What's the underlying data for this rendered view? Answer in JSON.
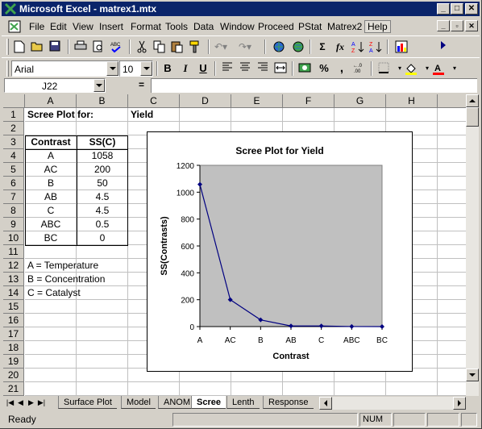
{
  "window": {
    "title": "Microsoft Excel - matrex1.mtx",
    "title_buttons": [
      "_",
      "□",
      "✕"
    ]
  },
  "menu": {
    "items": [
      "File",
      "Edit",
      "View",
      "Insert",
      "Format",
      "Tools",
      "Data",
      "Window",
      "Proceed",
      "PStat",
      "Matrex2",
      "Help"
    ],
    "doc_buttons": [
      "_",
      "▫",
      "✕"
    ]
  },
  "format_toolbar": {
    "font": "Arial",
    "size": "10",
    "bold": "B",
    "italic": "I",
    "underline": "U",
    "percent": "%",
    "comma": ","
  },
  "standard_toolbar": {
    "sigma": "Σ",
    "fx": "fx"
  },
  "formula_bar": {
    "name_box": "J22",
    "equals": "=",
    "content": ""
  },
  "columns": [
    "A",
    "B",
    "C",
    "D",
    "E",
    "F",
    "G",
    "H"
  ],
  "rows": [
    "1",
    "2",
    "3",
    "4",
    "5",
    "6",
    "7",
    "8",
    "9",
    "10",
    "11",
    "12",
    "13",
    "14",
    "15",
    "16",
    "17",
    "18",
    "19",
    "20",
    "21"
  ],
  "cells": {
    "a1": "Scree Plot for:",
    "c1": "Yield",
    "a3": "Contrast",
    "b3": "SS(C)",
    "table": [
      {
        "contrast": "A",
        "ss": "1058"
      },
      {
        "contrast": "AC",
        "ss": "200"
      },
      {
        "contrast": "B",
        "ss": "50"
      },
      {
        "contrast": "AB",
        "ss": "4.5"
      },
      {
        "contrast": "C",
        "ss": "4.5"
      },
      {
        "contrast": "ABC",
        "ss": "0.5"
      },
      {
        "contrast": "BC",
        "ss": "0"
      }
    ],
    "a12": "A = Temperature",
    "a13": "B = Concentration",
    "a14": "C = Catalyst"
  },
  "chart_data": {
    "type": "line",
    "title": "Scree Plot for Yield",
    "xlabel": "Contrast",
    "ylabel": "SS(Contrasts)",
    "categories": [
      "A",
      "AC",
      "B",
      "AB",
      "C",
      "ABC",
      "BC"
    ],
    "series": [
      {
        "values": [
          1058,
          200,
          50,
          4.5,
          4.5,
          0.5,
          0
        ]
      }
    ],
    "yticks": [
      "0",
      "200",
      "400",
      "600",
      "800",
      "1000",
      "1200"
    ],
    "ylim": [
      0,
      1200
    ],
    "plot_background": "#c0c0c0",
    "line_color": "#000080",
    "grid": false,
    "legend": "none"
  },
  "sheet_tabs": [
    "Surface Plot",
    "Model",
    "ANOM",
    "Scree",
    "Lenth",
    "Response"
  ],
  "active_tab": "Scree",
  "status": {
    "text": "Ready",
    "num": "NUM"
  }
}
